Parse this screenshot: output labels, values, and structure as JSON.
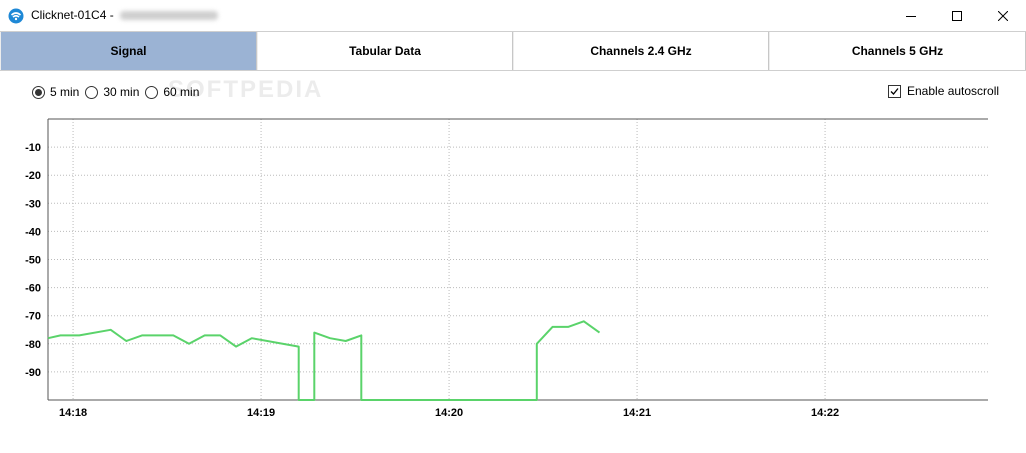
{
  "window": {
    "title": "Clicknet-01C4 -"
  },
  "tabs": [
    {
      "label": "Signal",
      "active": true
    },
    {
      "label": "Tabular Data",
      "active": false
    },
    {
      "label": "Channels 2.4 GHz",
      "active": false
    },
    {
      "label": "Channels 5 GHz",
      "active": false
    }
  ],
  "time_options": [
    {
      "label": "5 min",
      "selected": true
    },
    {
      "label": "30 min",
      "selected": false
    },
    {
      "label": "60 min",
      "selected": false
    }
  ],
  "autoscroll": {
    "label": "Enable autoscroll",
    "checked": true
  },
  "watermark": "SOFTPEDIA",
  "colors": {
    "accent": "#9bb3d4",
    "signal_line": "#5ad36a",
    "grid": "#bbbbbb"
  },
  "chart_data": {
    "type": "line",
    "y_ticks": [
      "-10",
      "-20",
      "-30",
      "-40",
      "-50",
      "-60",
      "-70",
      "-80",
      "-90"
    ],
    "x_ticks": [
      "14:18",
      "14:19",
      "14:20",
      "14:21",
      "14:22"
    ],
    "ylim": [
      -100,
      0
    ],
    "xlim_seconds": [
      -8,
      292
    ],
    "grid": true,
    "series": [
      {
        "values": [
          [
            -8,
            -78
          ],
          [
            -4,
            -77
          ],
          [
            2,
            -77
          ],
          [
            12,
            -75
          ],
          [
            17,
            -79
          ],
          [
            22,
            -77
          ],
          [
            32,
            -77
          ],
          [
            37,
            -80
          ],
          [
            42,
            -77
          ],
          [
            47,
            -77
          ],
          [
            52,
            -81
          ],
          [
            57,
            -78
          ],
          [
            72,
            -81
          ],
          [
            72,
            -100
          ],
          [
            77,
            -100
          ],
          [
            77,
            -76
          ],
          [
            82,
            -78
          ],
          [
            87,
            -79
          ],
          [
            92,
            -77
          ],
          [
            92,
            -100
          ],
          [
            148,
            -100
          ],
          [
            148,
            -80
          ],
          [
            153,
            -74
          ],
          [
            158,
            -74
          ],
          [
            163,
            -72
          ],
          [
            168,
            -76
          ]
        ]
      }
    ]
  }
}
